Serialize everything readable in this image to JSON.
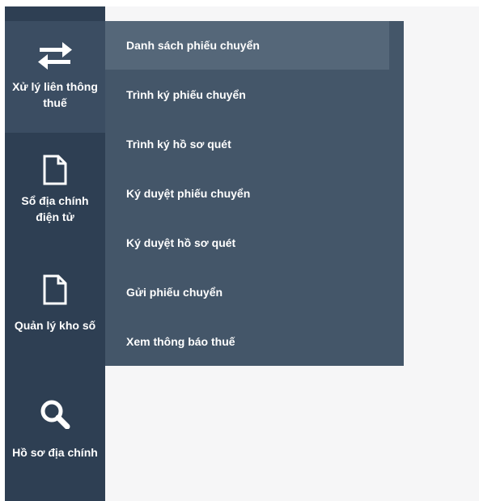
{
  "sidebar": {
    "items": [
      {
        "label": "Xử lý liên thông thuế",
        "icon": "transfer-arrows-icon",
        "active": true
      },
      {
        "label": "Sổ địa chính điện tử",
        "icon": "document-icon",
        "active": false
      },
      {
        "label": "Quản lý kho số",
        "icon": "document-icon",
        "active": false
      },
      {
        "label": "Hồ sơ địa chính",
        "icon": "search-icon",
        "active": false
      }
    ]
  },
  "submenu": {
    "items": [
      {
        "label": "Danh sách phiếu chuyển",
        "active": true
      },
      {
        "label": "Trình ký phiếu chuyển",
        "active": false
      },
      {
        "label": "Trình ký hồ sơ quét",
        "active": false
      },
      {
        "label": "Ký duyệt phiếu chuyển",
        "active": false
      },
      {
        "label": "Ký duyệt hồ sơ quét",
        "active": false
      },
      {
        "label": "Gửi phiếu chuyển",
        "active": false
      },
      {
        "label": "Xem thông báo thuế",
        "active": false
      }
    ]
  },
  "colors": {
    "sidebar_bg": "#2e3f53",
    "sidebar_active_bg": "#3b4d62",
    "submenu_bg": "#445669",
    "submenu_active_bg": "#556779",
    "content_bg": "#f6f6f7",
    "text": "#ffffff"
  }
}
